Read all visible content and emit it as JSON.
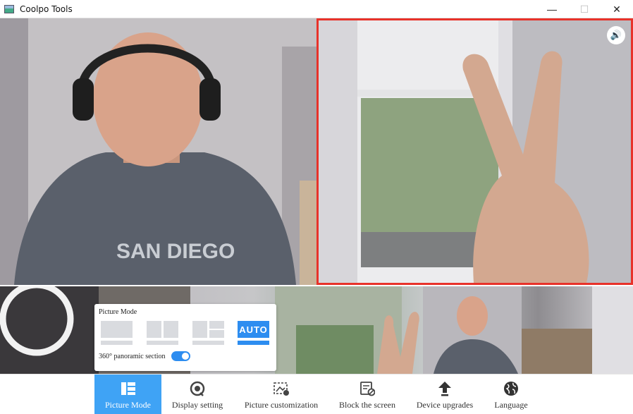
{
  "window": {
    "title": "Coolpo Tools",
    "minimize": "—",
    "maximize": "☐",
    "close": "✕"
  },
  "speaker_icon": "🔊",
  "picture_mode_popup": {
    "title": "Picture Mode",
    "auto_label": "AUTO",
    "panoramic_label": "360° panoramic section",
    "panoramic_enabled": true
  },
  "nav": {
    "items": [
      {
        "label": "Picture Mode",
        "icon": "layout-icon",
        "active": true
      },
      {
        "label": "Display setting",
        "icon": "camera-lens-icon",
        "active": false
      },
      {
        "label": "Picture customization",
        "icon": "image-edit-icon",
        "active": false
      },
      {
        "label": "Block the screen",
        "icon": "block-screen-icon",
        "active": false
      },
      {
        "label": "Device upgrades",
        "icon": "upload-arrow-icon",
        "active": false
      },
      {
        "label": "Language",
        "icon": "globe-icon",
        "active": false
      }
    ]
  },
  "colors": {
    "accent": "#2d8df0",
    "nav_active": "#3fa3f5",
    "focus_border": "#e8322a"
  }
}
